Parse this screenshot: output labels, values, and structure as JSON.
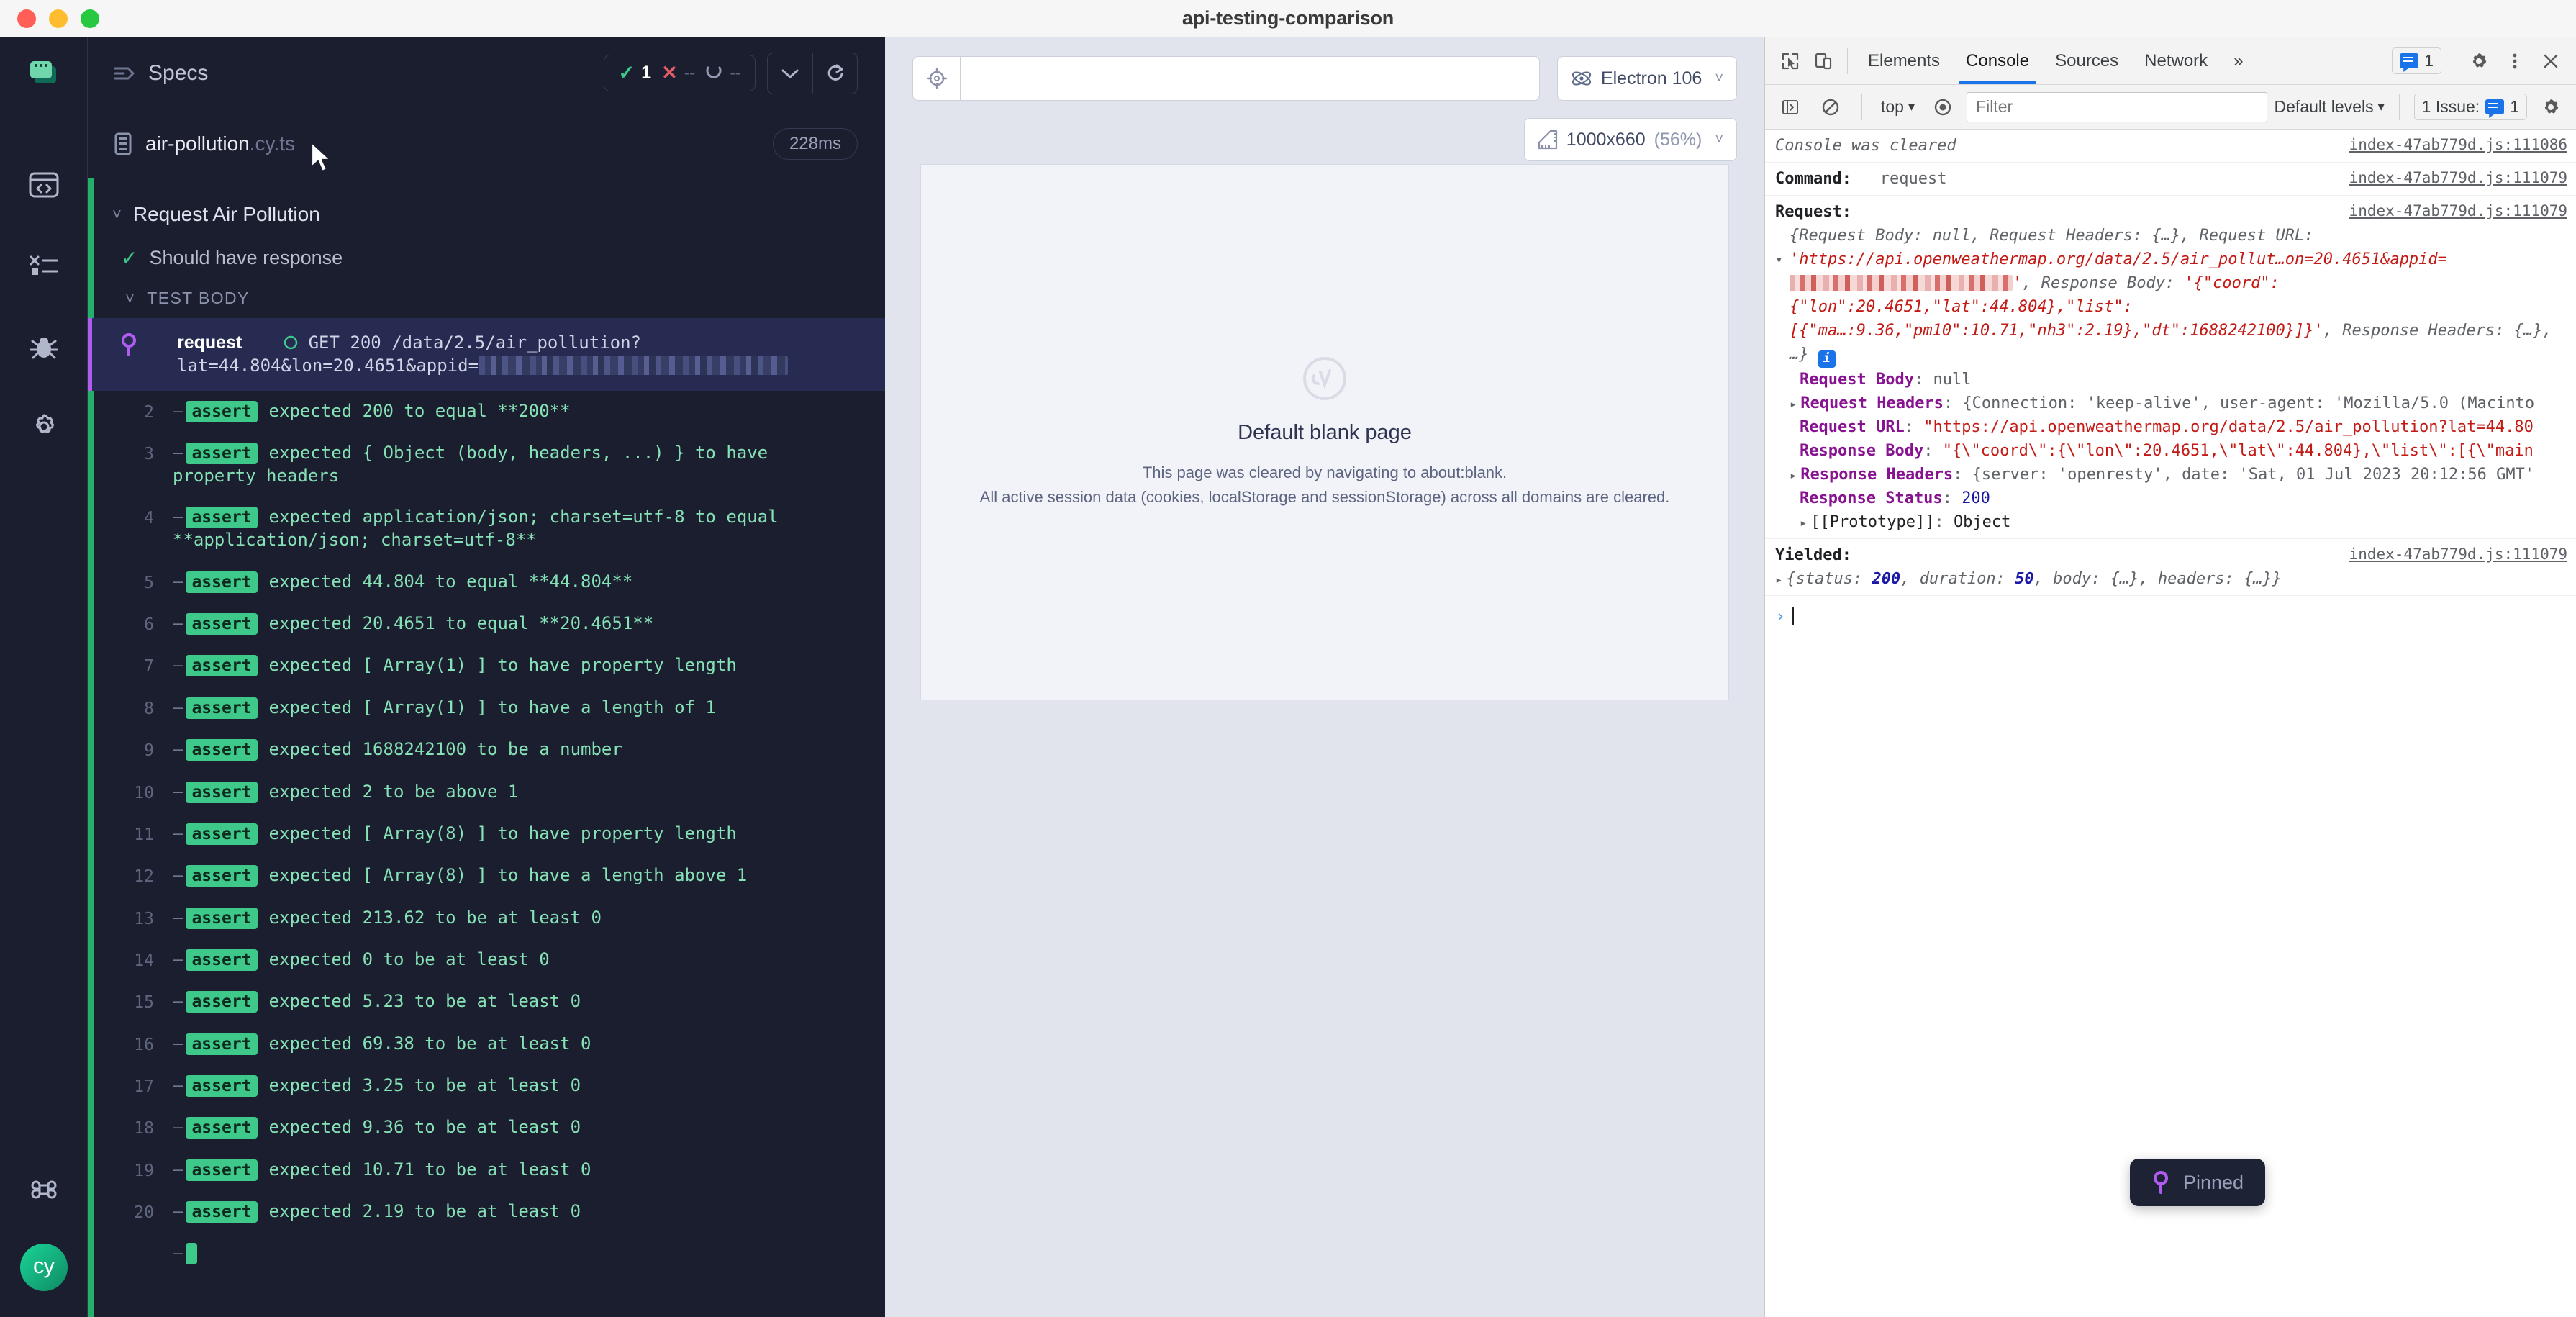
{
  "window": {
    "title": "api-testing-comparison"
  },
  "rail": {
    "items": [
      {
        "name": "specs-icon",
        "label": "Specs"
      },
      {
        "name": "runs-icon",
        "label": "Runs"
      },
      {
        "name": "debug-icon",
        "label": "Debug"
      },
      {
        "name": "settings-icon",
        "label": "Settings"
      }
    ],
    "shortcuts_label": "Keyboard shortcuts",
    "logo_text": "cy"
  },
  "reporter": {
    "header": {
      "title": "Specs",
      "stats": {
        "passed": "1",
        "failed": "--",
        "pending": "--"
      },
      "collapse_label": "Collapse all",
      "restart_label": "Restart"
    },
    "spec": {
      "name": "air-pollution",
      "ext": ".cy.ts",
      "duration": "228ms"
    },
    "suite": "Request Air Pollution",
    "test": "Should have response",
    "section": "TEST BODY",
    "commands": [
      {
        "num": "1",
        "type": "request",
        "name": "request",
        "method": "GET",
        "status": "200",
        "url_line1": "/data/2.5/air_pollution?",
        "url_line2": "lat=44.804&lon=20.4651&appid=",
        "redacted": true,
        "pinned": true
      },
      {
        "num": "2",
        "type": "assert",
        "tag": "assert",
        "text": "expected  200  to equal  **200**"
      },
      {
        "num": "3",
        "type": "assert",
        "tag": "assert",
        "text": "expected  { Object (body, headers, ...) }  to have property  headers"
      },
      {
        "num": "4",
        "type": "assert",
        "tag": "assert",
        "text": "expected  application/json; charset=utf-8  to equal  **application/json; charset=utf-8**"
      },
      {
        "num": "5",
        "type": "assert",
        "tag": "assert",
        "text": "expected  44.804  to equal  **44.804**"
      },
      {
        "num": "6",
        "type": "assert",
        "tag": "assert",
        "text": "expected  20.4651  to equal  **20.4651**"
      },
      {
        "num": "7",
        "type": "assert",
        "tag": "assert",
        "text": "expected  [ Array(1) ]  to have property  length"
      },
      {
        "num": "8",
        "type": "assert",
        "tag": "assert",
        "text": "expected  [ Array(1) ]  to have a length of  1"
      },
      {
        "num": "9",
        "type": "assert",
        "tag": "assert",
        "text": "expected  1688242100  to be a number"
      },
      {
        "num": "10",
        "type": "assert",
        "tag": "assert",
        "text": "expected  2  to be above  1"
      },
      {
        "num": "11",
        "type": "assert",
        "tag": "assert",
        "text": "expected  [ Array(8) ]  to have property  length"
      },
      {
        "num": "12",
        "type": "assert",
        "tag": "assert",
        "text": "expected  [ Array(8) ]  to have a length above  1"
      },
      {
        "num": "13",
        "type": "assert",
        "tag": "assert",
        "text": "expected  213.62  to be at least  0"
      },
      {
        "num": "14",
        "type": "assert",
        "tag": "assert",
        "text": "expected  0  to be at least  0"
      },
      {
        "num": "15",
        "type": "assert",
        "tag": "assert",
        "text": "expected  5.23  to be at least  0"
      },
      {
        "num": "16",
        "type": "assert",
        "tag": "assert",
        "text": "expected  69.38  to be at least  0"
      },
      {
        "num": "17",
        "type": "assert",
        "tag": "assert",
        "text": "expected  3.25  to be at least  0"
      },
      {
        "num": "18",
        "type": "assert",
        "tag": "assert",
        "text": "expected  9.36  to be at least  0"
      },
      {
        "num": "19",
        "type": "assert",
        "tag": "assert",
        "text": "expected  10.71  to be at least  0"
      },
      {
        "num": "20",
        "type": "assert",
        "tag": "assert",
        "text": "expected  2.19  to be at least  0"
      }
    ]
  },
  "aut": {
    "url_value": "",
    "url_placeholder": "",
    "browser": "Electron 106",
    "viewport_size": "1000x660",
    "viewport_scale": "(56%)",
    "blank": {
      "title": "Default blank page",
      "line1": "This page was cleared by navigating to about:blank.",
      "line2": "All active session data (cookies, localStorage and sessionStorage) across all domains are cleared."
    },
    "pinned_label": "Pinned"
  },
  "devtools": {
    "tabs": [
      {
        "label": "Elements",
        "active": false
      },
      {
        "label": "Console",
        "active": true
      },
      {
        "label": "Sources",
        "active": false
      },
      {
        "label": "Network",
        "active": false
      }
    ],
    "more_tabs": "»",
    "issues_count": "1",
    "filterbar": {
      "context": "top",
      "filter_placeholder": "Filter",
      "levels": "Default levels",
      "issues_label": "1 Issue:",
      "issues_count": "1"
    },
    "console": {
      "cleared_msg": "Console was cleared",
      "cleared_src": "index-47ab779d.js:111086",
      "command_label": "Command:",
      "command_value": "request",
      "command_src": "index-47ab779d.js:111079",
      "request_label": "Request:",
      "request_src": "index-47ab779d.js:111079",
      "summary": {
        "p1": "{Request Body: ",
        "null1": "null",
        "p2": ", Request Headers: {…}, Request URL: ",
        "url": "'https://api.openweathermap.org/data/2.5/air_pollut…on=20.4651&appid=",
        "url_tail": "'",
        "p3": ", Response Body: ",
        "body": "'{\"coord\":{\"lon\":20.4651,\"lat\":44.804},\"list\":[{\"ma…:9.36,\"pm10\":10.71,\"nh3\":2.19},\"dt\":1688242100}]}'",
        "p4": ", Response Headers: {…}, …}"
      },
      "props": [
        {
          "key": "Request Body",
          "value": "null",
          "kind": "null",
          "expandable": false
        },
        {
          "key": "Request Headers",
          "value": "{Connection: 'keep-alive', user-agent: 'Mozilla/5.0 (Macinto",
          "kind": "obj",
          "expandable": true
        },
        {
          "key": "Request URL",
          "value": "\"https://api.openweathermap.org/data/2.5/air_pollution?lat=44.80",
          "kind": "string",
          "expandable": false
        },
        {
          "key": "Response Body",
          "value": "\"{\\\"coord\\\":{\\\"lon\\\":20.4651,\\\"lat\\\":44.804},\\\"list\\\":[{\\\"main",
          "kind": "string",
          "expandable": false
        },
        {
          "key": "Response Headers",
          "value": "{server: 'openresty', date: 'Sat, 01 Jul 2023 20:12:56 GMT'",
          "kind": "obj",
          "expandable": true
        },
        {
          "key": "Response Status",
          "value": "200",
          "kind": "number",
          "expandable": false
        },
        {
          "key": "[[Prototype]]",
          "value": "Object",
          "kind": "proto",
          "expandable": true
        }
      ],
      "yielded_label": "Yielded:",
      "yielded_src": "index-47ab779d.js:111079",
      "yielded_value": "{status: 200, duration: 50, body: {…}, headers: {…}}",
      "yielded_parts": {
        "pre": "{status: ",
        "status": "200",
        "mid1": ", duration: ",
        "duration": "50",
        "mid2": ", body: {…}, headers: {…}}"
      }
    }
  },
  "colors": {
    "reporter_bg": "#1b1e2e",
    "accent_green": "#3ec98a",
    "accent_purple": "#b05cf0",
    "devtools_blue": "#1a73e8",
    "fail_red": "#e45c6a"
  }
}
